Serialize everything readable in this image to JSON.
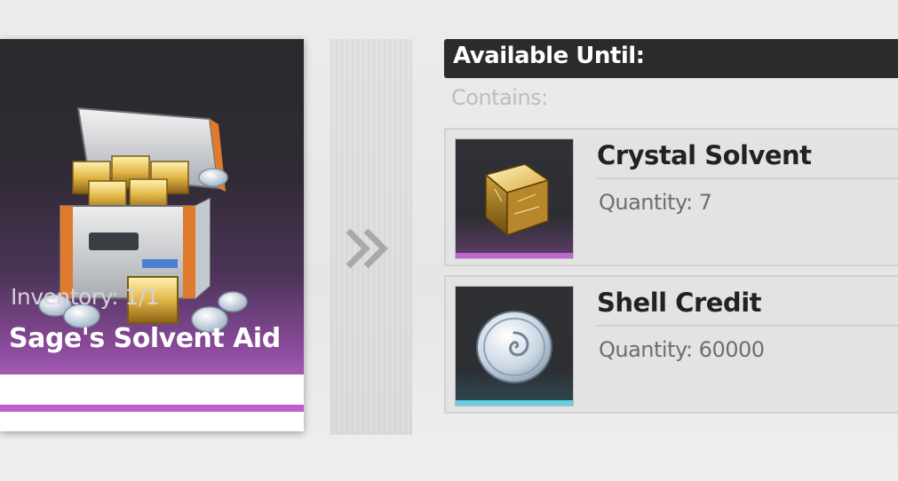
{
  "item": {
    "inventory": "Inventory: 1/1",
    "name": "Sage's Solvent Aid",
    "icon": "supply-chest-icon",
    "rarity_color": "#b960c9"
  },
  "arrow_icon": "double-chevron-right-icon",
  "details": {
    "available_until": "Available Until:",
    "contains_label": "Contains:",
    "rewards": [
      {
        "name": "Crystal Solvent",
        "quantity": "Quantity: 7",
        "icon": "crystal-solvent-icon",
        "rarity_color": "#c066d0"
      },
      {
        "name": "Shell Credit",
        "quantity": "Quantity: 60000",
        "icon": "shell-credit-icon",
        "rarity_color": "#66cfe0"
      }
    ]
  }
}
